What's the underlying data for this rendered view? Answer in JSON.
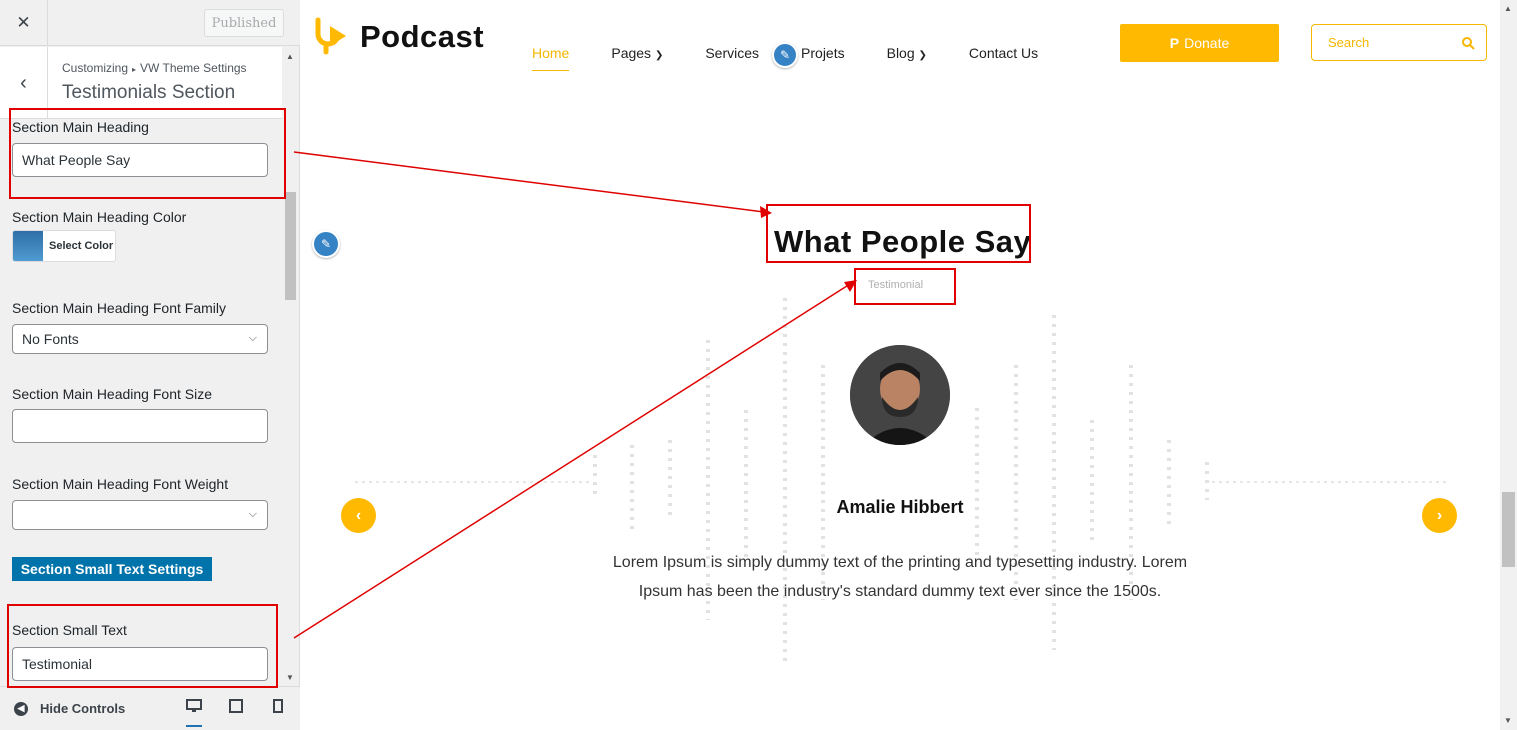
{
  "customizer": {
    "close_icon": "close-icon",
    "publish_label": "Published",
    "back_icon": "chevron-left-icon",
    "breadcrumb": {
      "root": "Customizing",
      "separator": "▸",
      "parent": "VW Theme Settings"
    },
    "section_title": "Testimonials Section",
    "controls": {
      "main_heading_label": "Section Main Heading",
      "main_heading_value": "What People Say",
      "heading_color_label": "Section Main Heading Color",
      "select_color_label": "Select Color",
      "font_family_label": "Section Main Heading Font Family",
      "font_family_value": "No Fonts",
      "font_size_label": "Section Main Heading Font Size",
      "font_size_value": "",
      "font_weight_label": "Section Main Heading Font Weight",
      "font_weight_value": "",
      "small_text_settings_label": "Section Small Text Settings",
      "small_text_label": "Section Small Text",
      "small_text_value": "Testimonial"
    },
    "footer": {
      "hide_controls_label": "Hide Controls",
      "devices": [
        "desktop-icon",
        "tablet-icon",
        "mobile-icon"
      ]
    }
  },
  "site": {
    "logo_text": "Podcast",
    "nav": [
      {
        "label": "Home",
        "active": true
      },
      {
        "label": "Pages",
        "dropdown": true
      },
      {
        "label": "Services"
      },
      {
        "label": "Projets"
      },
      {
        "label": "Blog",
        "dropdown": true
      },
      {
        "label": "Contact Us"
      }
    ],
    "donate_label": "Donate",
    "search_placeholder": "Search",
    "testimonial": {
      "heading": "What People Say",
      "small_text": "Testimonial",
      "name": "Amalie Hibbert",
      "quote": "Lorem Ipsum is simply dummy text of the printing and typesetting industry. Lorem Ipsum has been the industry's standard dummy text ever since the 1500s."
    }
  },
  "colors": {
    "accent": "#ffb900",
    "wp_blue": "#0073aa",
    "annotation_red": "#e00000"
  }
}
